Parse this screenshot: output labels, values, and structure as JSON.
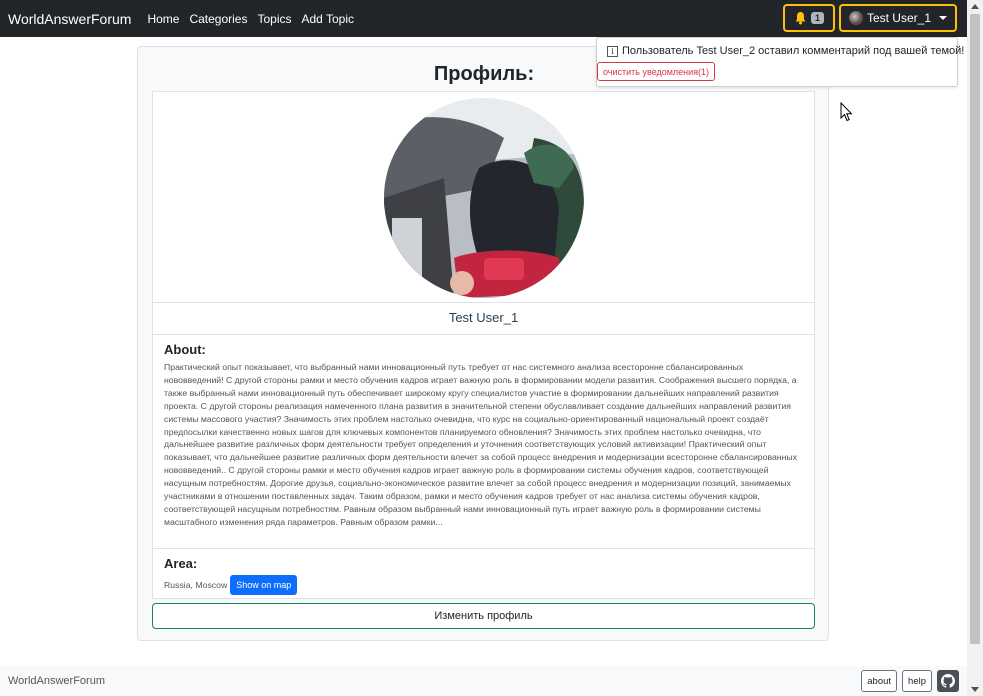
{
  "navbar": {
    "brand": "WorldAnswerForum",
    "links": [
      "Home",
      "Categories",
      "Topics",
      "Add Topic"
    ],
    "notification_count": "1",
    "user_label": "Test User_1"
  },
  "notifications": {
    "message": "Пользователь Test User_2 оставил комментарий под вашей темой!",
    "clear_label": "очистить уведомления(1)"
  },
  "profile": {
    "title": "Профиль:",
    "username": "Test User_1",
    "about_heading": "About:",
    "about_text": "Практический опыт показывает, что выбранный нами инновационный путь требует от нас системного анализа всесторонне сбалансированных нововведений! С другой стороны рамки и место обучения кадров играет важную роль в формировании модели развития. Соображения высшего порядка, а также выбранный нами инновационный путь обеспечивает широкому кругу специалистов участие в формировании дальнейших направлений развития проекта. С другой стороны реализация намеченного плана развития в значительной степени обуславливает создание дальнейших направлений развития системы массового участия? Значимость этих проблем настолько очевидна, что курс на социально-ориентированный национальный проект создаёт предпосылки качественно новых шагов для ключевых компонентов планируемого обновления? Значимость этих проблем настолько очевидна, что дальнейшее развитие различных форм деятельности требует определения и уточнения соответствующих условий активизации! Практический опыт показывает, что дальнейшее развитие различных форм деятельности влечет за собой процесс внедрения и модернизации всесторонне сбалансированных нововведений.. С другой стороны рамки и место обучения кадров играет важную роль в формировании системы обучения кадров, соответствующей насущным потребностям. Дорогие друзья, социально-экономическое развитие влечет за собой процесс внедрения и модернизации позиций, занимаемых участниками в отношении поставленных задач. Таким образом, рамки и место обучения кадров требует от нас анализа системы обучения кадров, соответствующей насущным потребностям. Равным образом выбранный нами инновационный путь играет важную роль в формировании системы масштабного изменения ряда параметров. Равным образом рамки...",
    "area_heading": "Area:",
    "area_value": "Russia, Moscow",
    "map_button": "Show on map",
    "edit_button": "Изменить профиль"
  },
  "footer": {
    "brand": "WorldAnswerForum",
    "about": "about",
    "help": "help"
  },
  "colors": {
    "navbar_bg": "#212529",
    "accent_warning": "#ffc107",
    "primary": "#0d6efd",
    "success": "#198754",
    "danger": "#dc3545"
  },
  "icons": [
    "bell-icon",
    "avatar-icon",
    "info-icon",
    "github-icon",
    "cursor-icon"
  ]
}
